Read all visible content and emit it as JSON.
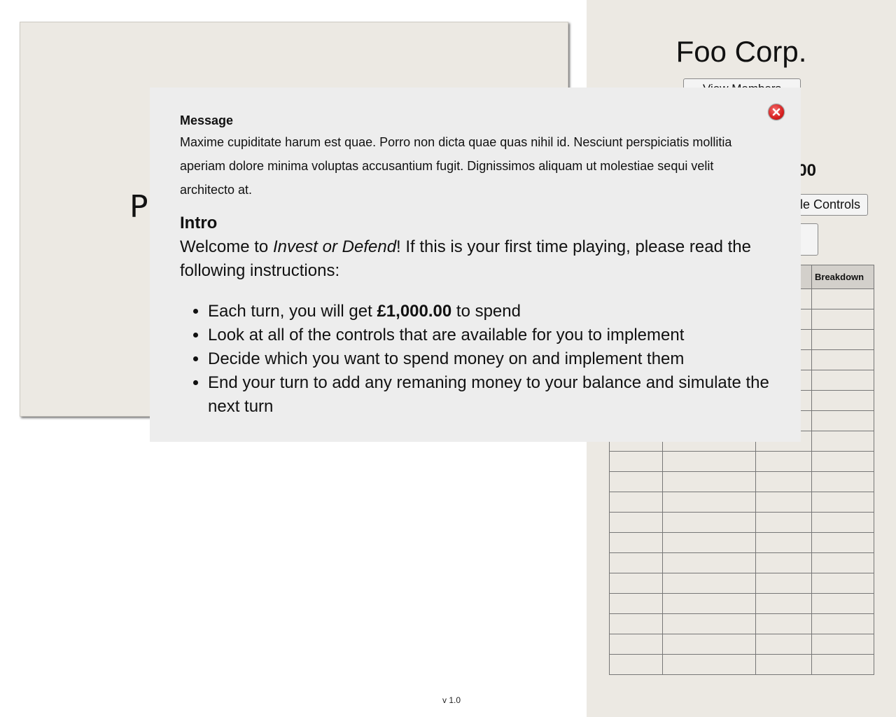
{
  "board": {
    "title": "Pl"
  },
  "version": "v 1.0",
  "sidebar": {
    "company_name": "Foo Corp.",
    "view_members_label": "View Members",
    "balance": "00",
    "controls_label": "le Controls",
    "table": {
      "headers": [
        "",
        "",
        "",
        "Breakdown"
      ],
      "row_count": 19
    }
  },
  "modal": {
    "message_heading": "Message",
    "message_body": "Maxime cupiditate harum est quae. Porro non dicta quae quas nihil id. Nesciunt perspiciatis mollitia aperiam dolore minima voluptas accusantium fugit. Dignissimos aliquam ut molestiae sequi velit architecto at.",
    "intro_heading": "Intro",
    "intro_prefix": "Welcome to ",
    "intro_game_name": "Invest or Defend",
    "intro_suffix": "! If this is your first time playing, please read the following instructions:",
    "steps": [
      {
        "prefix": "Each turn, you will get ",
        "bold": "£1,000.00",
        "suffix": " to spend"
      },
      {
        "prefix": "Look at all of the controls that are available for you to implement",
        "bold": "",
        "suffix": ""
      },
      {
        "prefix": "Decide which you want to spend money on and implement them",
        "bold": "",
        "suffix": ""
      },
      {
        "prefix": "End your turn to add any remaning money to your balance and simulate the next turn",
        "bold": "",
        "suffix": ""
      }
    ],
    "close_icon": "close-icon"
  }
}
